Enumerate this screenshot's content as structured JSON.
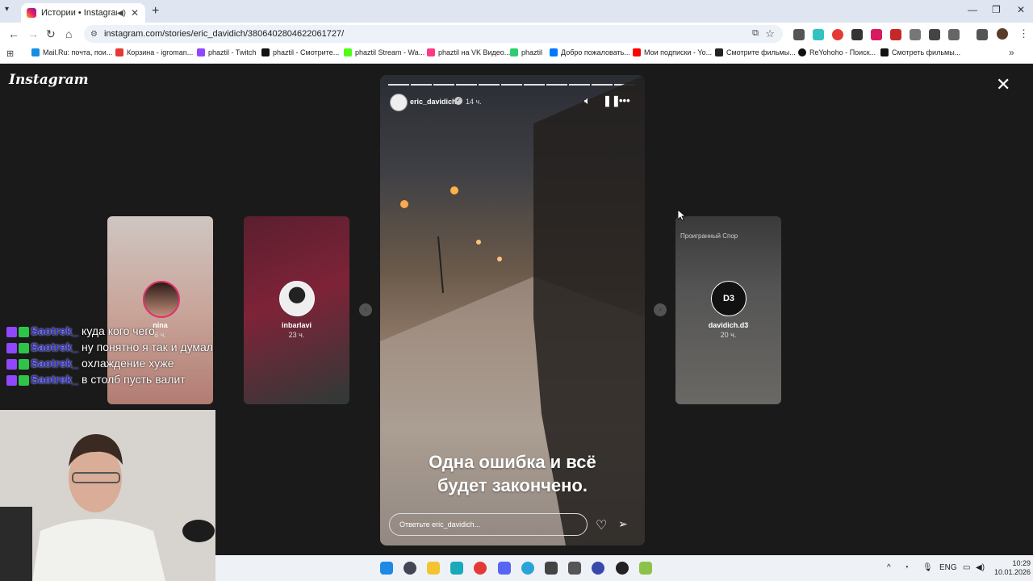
{
  "browser": {
    "tab_title": "Истории • Instagram",
    "url": "instagram.com/stories/eric_davidich/3806402804622061727/",
    "new_tab_label": "+",
    "bookmarks": [
      {
        "label": "Mail.Ru: почта, пои...",
        "color": "#168de2"
      },
      {
        "label": "Корзина - igroman...",
        "color": "#e53935"
      },
      {
        "label": "phaztil - Twitch",
        "color": "#9146ff"
      },
      {
        "label": "phaztil - Смотрите...",
        "color": "#111111"
      },
      {
        "label": "phaztil Stream - Wa...",
        "color": "#53fc18"
      },
      {
        "label": "phaztil на VK Видео...",
        "color": "#ff3985"
      },
      {
        "label": "phaztil",
        "color": "#2ecc71"
      },
      {
        "label": "Добро пожаловать...",
        "color": "#0077ff"
      },
      {
        "label": "Мои подписки - Yo...",
        "color": "#ff0000"
      },
      {
        "label": "Смотрите фильмы...",
        "color": "#222222"
      },
      {
        "label": "ReYohoho - Поиск...",
        "color": "#111111"
      },
      {
        "label": "Смотреть фильмы...",
        "color": "#111111"
      }
    ]
  },
  "instagram": {
    "logo": "Instagram",
    "side_stories": [
      {
        "username": "nina",
        "time": "6 ч."
      },
      {
        "username": "inbarlavi",
        "time": "23 ч."
      },
      {
        "username": "davidich.d3",
        "time": "20 ч.",
        "overlay": "Проигранный Спор"
      }
    ],
    "story": {
      "username": "eric_davidich",
      "time": "14 ч.",
      "caption_line1": "Одна ошибка и всё",
      "caption_line2": "будет закончено.",
      "reply_placeholder": "Ответьте eric_davidich...",
      "progress_segments": 11,
      "progress_filled": 10
    }
  },
  "chat": [
    {
      "user": "Saotrek_",
      "message": "куда кого чего"
    },
    {
      "user": "Saotrek_",
      "message": "ну понятно я так и думал"
    },
    {
      "user": "Saotrek_",
      "message": "охлаждение хуже"
    },
    {
      "user": "Saotrek_",
      "message": "в столб пусть валит"
    }
  ],
  "taskbar": {
    "lang": "ENG",
    "time": "10:29",
    "date": "10.01.2026"
  }
}
